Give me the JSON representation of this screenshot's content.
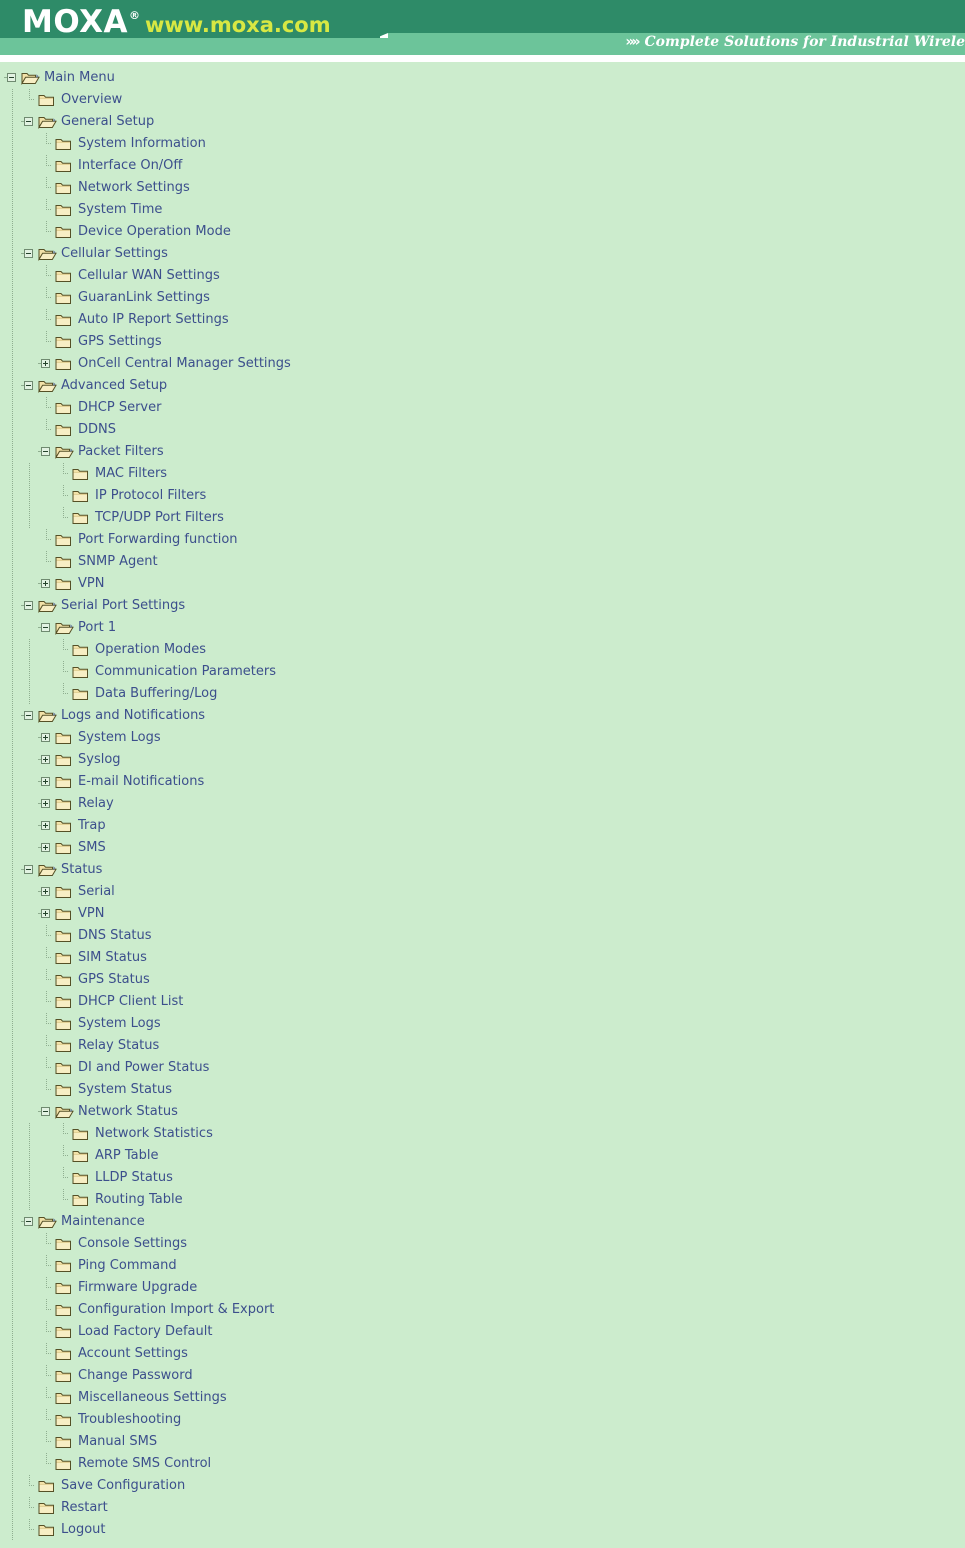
{
  "header": {
    "logo_text": "MOXA",
    "logo_reg": "®",
    "logo_url": "www.moxa.com",
    "tagline_chevrons": "»»",
    "tagline": "Complete Solutions for Industrial Wirele",
    "colors": {
      "banner_dark": "#2e8b68",
      "banner_light": "#6cc49a",
      "logo_url_color": "#d8e843",
      "panel_bg": "#cceccd",
      "link_color": "#3c4f8c"
    }
  },
  "tree": {
    "root_label": "Main Menu",
    "nodes": [
      {
        "label": "Main Menu",
        "depth": 0,
        "state": "expanded",
        "icon": "folder-open"
      },
      {
        "label": "Overview",
        "depth": 1,
        "state": "leaf",
        "icon": "folder-closed"
      },
      {
        "label": "General Setup",
        "depth": 1,
        "state": "expanded",
        "icon": "folder-open"
      },
      {
        "label": "System Information",
        "depth": 2,
        "state": "leaf",
        "icon": "folder-closed"
      },
      {
        "label": "Interface On/Off",
        "depth": 2,
        "state": "leaf",
        "icon": "folder-closed"
      },
      {
        "label": "Network Settings",
        "depth": 2,
        "state": "leaf",
        "icon": "folder-closed"
      },
      {
        "label": "System Time",
        "depth": 2,
        "state": "leaf",
        "icon": "folder-closed"
      },
      {
        "label": "Device Operation Mode",
        "depth": 2,
        "state": "leaf",
        "icon": "folder-closed"
      },
      {
        "label": "Cellular Settings",
        "depth": 1,
        "state": "expanded",
        "icon": "folder-open"
      },
      {
        "label": "Cellular WAN Settings",
        "depth": 2,
        "state": "leaf",
        "icon": "folder-closed"
      },
      {
        "label": "GuaranLink Settings",
        "depth": 2,
        "state": "leaf",
        "icon": "folder-closed"
      },
      {
        "label": "Auto IP Report Settings",
        "depth": 2,
        "state": "leaf",
        "icon": "folder-closed"
      },
      {
        "label": "GPS Settings",
        "depth": 2,
        "state": "leaf",
        "icon": "folder-closed"
      },
      {
        "label": "OnCell Central Manager Settings",
        "depth": 2,
        "state": "collapsed",
        "icon": "folder-closed"
      },
      {
        "label": "Advanced Setup",
        "depth": 1,
        "state": "expanded",
        "icon": "folder-open"
      },
      {
        "label": "DHCP Server",
        "depth": 2,
        "state": "leaf",
        "icon": "folder-closed"
      },
      {
        "label": "DDNS",
        "depth": 2,
        "state": "leaf",
        "icon": "folder-closed"
      },
      {
        "label": "Packet Filters",
        "depth": 2,
        "state": "expanded",
        "icon": "folder-open"
      },
      {
        "label": "MAC Filters",
        "depth": 3,
        "state": "leaf",
        "icon": "folder-closed"
      },
      {
        "label": "IP Protocol Filters",
        "depth": 3,
        "state": "leaf",
        "icon": "folder-closed"
      },
      {
        "label": "TCP/UDP Port Filters",
        "depth": 3,
        "state": "leaf",
        "icon": "folder-closed"
      },
      {
        "label": "Port Forwarding function",
        "depth": 2,
        "state": "leaf",
        "icon": "folder-closed"
      },
      {
        "label": "SNMP Agent",
        "depth": 2,
        "state": "leaf",
        "icon": "folder-closed"
      },
      {
        "label": "VPN",
        "depth": 2,
        "state": "collapsed",
        "icon": "folder-closed"
      },
      {
        "label": "Serial Port Settings",
        "depth": 1,
        "state": "expanded",
        "icon": "folder-open"
      },
      {
        "label": "Port 1",
        "depth": 2,
        "state": "expanded",
        "icon": "folder-open"
      },
      {
        "label": "Operation Modes",
        "depth": 3,
        "state": "leaf",
        "icon": "folder-closed"
      },
      {
        "label": "Communication Parameters",
        "depth": 3,
        "state": "leaf",
        "icon": "folder-closed"
      },
      {
        "label": "Data Buffering/Log",
        "depth": 3,
        "state": "leaf",
        "icon": "folder-closed"
      },
      {
        "label": "Logs and Notifications",
        "depth": 1,
        "state": "expanded",
        "icon": "folder-open"
      },
      {
        "label": "System Logs",
        "depth": 2,
        "state": "collapsed",
        "icon": "folder-closed"
      },
      {
        "label": "Syslog",
        "depth": 2,
        "state": "collapsed",
        "icon": "folder-closed"
      },
      {
        "label": "E-mail Notifications",
        "depth": 2,
        "state": "collapsed",
        "icon": "folder-closed"
      },
      {
        "label": "Relay",
        "depth": 2,
        "state": "collapsed",
        "icon": "folder-closed"
      },
      {
        "label": "Trap",
        "depth": 2,
        "state": "collapsed",
        "icon": "folder-closed"
      },
      {
        "label": "SMS",
        "depth": 2,
        "state": "collapsed",
        "icon": "folder-closed"
      },
      {
        "label": "Status",
        "depth": 1,
        "state": "expanded",
        "icon": "folder-open"
      },
      {
        "label": "Serial",
        "depth": 2,
        "state": "collapsed",
        "icon": "folder-closed"
      },
      {
        "label": "VPN",
        "depth": 2,
        "state": "collapsed",
        "icon": "folder-closed"
      },
      {
        "label": "DNS Status",
        "depth": 2,
        "state": "leaf",
        "icon": "folder-closed"
      },
      {
        "label": "SIM Status",
        "depth": 2,
        "state": "leaf",
        "icon": "folder-closed"
      },
      {
        "label": "GPS Status",
        "depth": 2,
        "state": "leaf",
        "icon": "folder-closed"
      },
      {
        "label": "DHCP Client List",
        "depth": 2,
        "state": "leaf",
        "icon": "folder-closed"
      },
      {
        "label": "System Logs",
        "depth": 2,
        "state": "leaf",
        "icon": "folder-closed"
      },
      {
        "label": "Relay Status",
        "depth": 2,
        "state": "leaf",
        "icon": "folder-closed"
      },
      {
        "label": "DI and Power Status",
        "depth": 2,
        "state": "leaf",
        "icon": "folder-closed"
      },
      {
        "label": "System Status",
        "depth": 2,
        "state": "leaf",
        "icon": "folder-closed"
      },
      {
        "label": "Network Status",
        "depth": 2,
        "state": "expanded",
        "icon": "folder-open"
      },
      {
        "label": "Network Statistics",
        "depth": 3,
        "state": "leaf",
        "icon": "folder-closed"
      },
      {
        "label": "ARP Table",
        "depth": 3,
        "state": "leaf",
        "icon": "folder-closed"
      },
      {
        "label": "LLDP Status",
        "depth": 3,
        "state": "leaf",
        "icon": "folder-closed"
      },
      {
        "label": "Routing Table",
        "depth": 3,
        "state": "leaf",
        "icon": "folder-closed"
      },
      {
        "label": "Maintenance",
        "depth": 1,
        "state": "expanded",
        "icon": "folder-open"
      },
      {
        "label": "Console Settings",
        "depth": 2,
        "state": "leaf",
        "icon": "folder-closed"
      },
      {
        "label": "Ping Command",
        "depth": 2,
        "state": "leaf",
        "icon": "folder-closed"
      },
      {
        "label": "Firmware Upgrade",
        "depth": 2,
        "state": "leaf",
        "icon": "folder-closed"
      },
      {
        "label": "Configuration Import & Export",
        "depth": 2,
        "state": "leaf",
        "icon": "folder-closed"
      },
      {
        "label": "Load Factory Default",
        "depth": 2,
        "state": "leaf",
        "icon": "folder-closed"
      },
      {
        "label": "Account Settings",
        "depth": 2,
        "state": "leaf",
        "icon": "folder-closed"
      },
      {
        "label": "Change Password",
        "depth": 2,
        "state": "leaf",
        "icon": "folder-closed"
      },
      {
        "label": "Miscellaneous Settings",
        "depth": 2,
        "state": "leaf",
        "icon": "folder-closed"
      },
      {
        "label": "Troubleshooting",
        "depth": 2,
        "state": "leaf",
        "icon": "folder-closed"
      },
      {
        "label": "Manual SMS",
        "depth": 2,
        "state": "leaf",
        "icon": "folder-closed"
      },
      {
        "label": "Remote SMS Control",
        "depth": 2,
        "state": "leaf",
        "icon": "folder-closed"
      },
      {
        "label": "Save Configuration",
        "depth": 1,
        "state": "leaf",
        "icon": "folder-closed"
      },
      {
        "label": "Restart",
        "depth": 1,
        "state": "leaf",
        "icon": "folder-closed"
      },
      {
        "label": "Logout",
        "depth": 1,
        "state": "leaf",
        "icon": "folder-closed"
      }
    ]
  }
}
